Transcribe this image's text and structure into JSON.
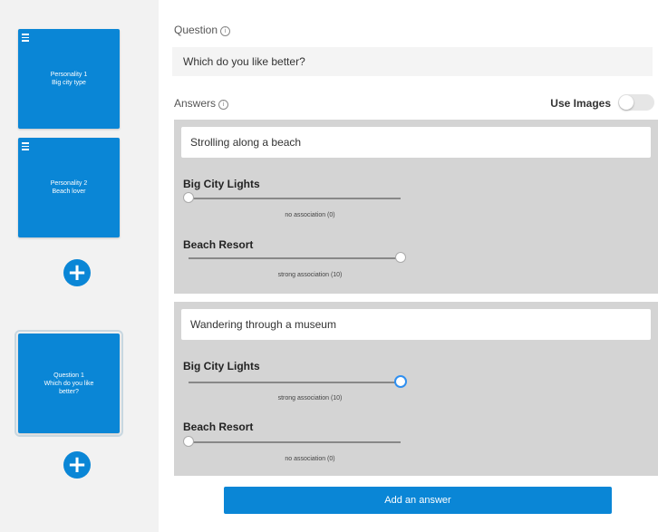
{
  "sidebar": {
    "cards": [
      {
        "line1": "Personality 1",
        "line2": "Big city type"
      },
      {
        "line1": "Personality 2",
        "line2": "Beach lover"
      },
      {
        "line1": "Question 1",
        "line2": "Which do you like",
        "line3": "better?"
      }
    ],
    "add_symbol": "+"
  },
  "question": {
    "label": "Question",
    "info_icon": "i",
    "value": "Which do you like better?"
  },
  "answers": {
    "label": "Answers",
    "info_icon": "i",
    "use_images_label": "Use Images",
    "use_images_on": false,
    "items": [
      {
        "text": "Strolling along a beach",
        "results": [
          {
            "name": "Big City Lights",
            "value": 0,
            "caption": "no association (0)"
          },
          {
            "name": "Beach Resort",
            "value": 1,
            "caption": "strong association (10)"
          }
        ]
      },
      {
        "text": "Wandering through a museum",
        "results": [
          {
            "name": "Big City Lights",
            "value": 1,
            "caption": "strong association (10)"
          },
          {
            "name": "Beach Resort",
            "value": 0,
            "caption": "no association (0)"
          }
        ]
      }
    ]
  },
  "add_answer_label": "Add an answer",
  "colors": {
    "accent": "#0a86d6",
    "answer_bg": "#d4d4d4",
    "sidebar_bg": "#f2f2f2"
  }
}
